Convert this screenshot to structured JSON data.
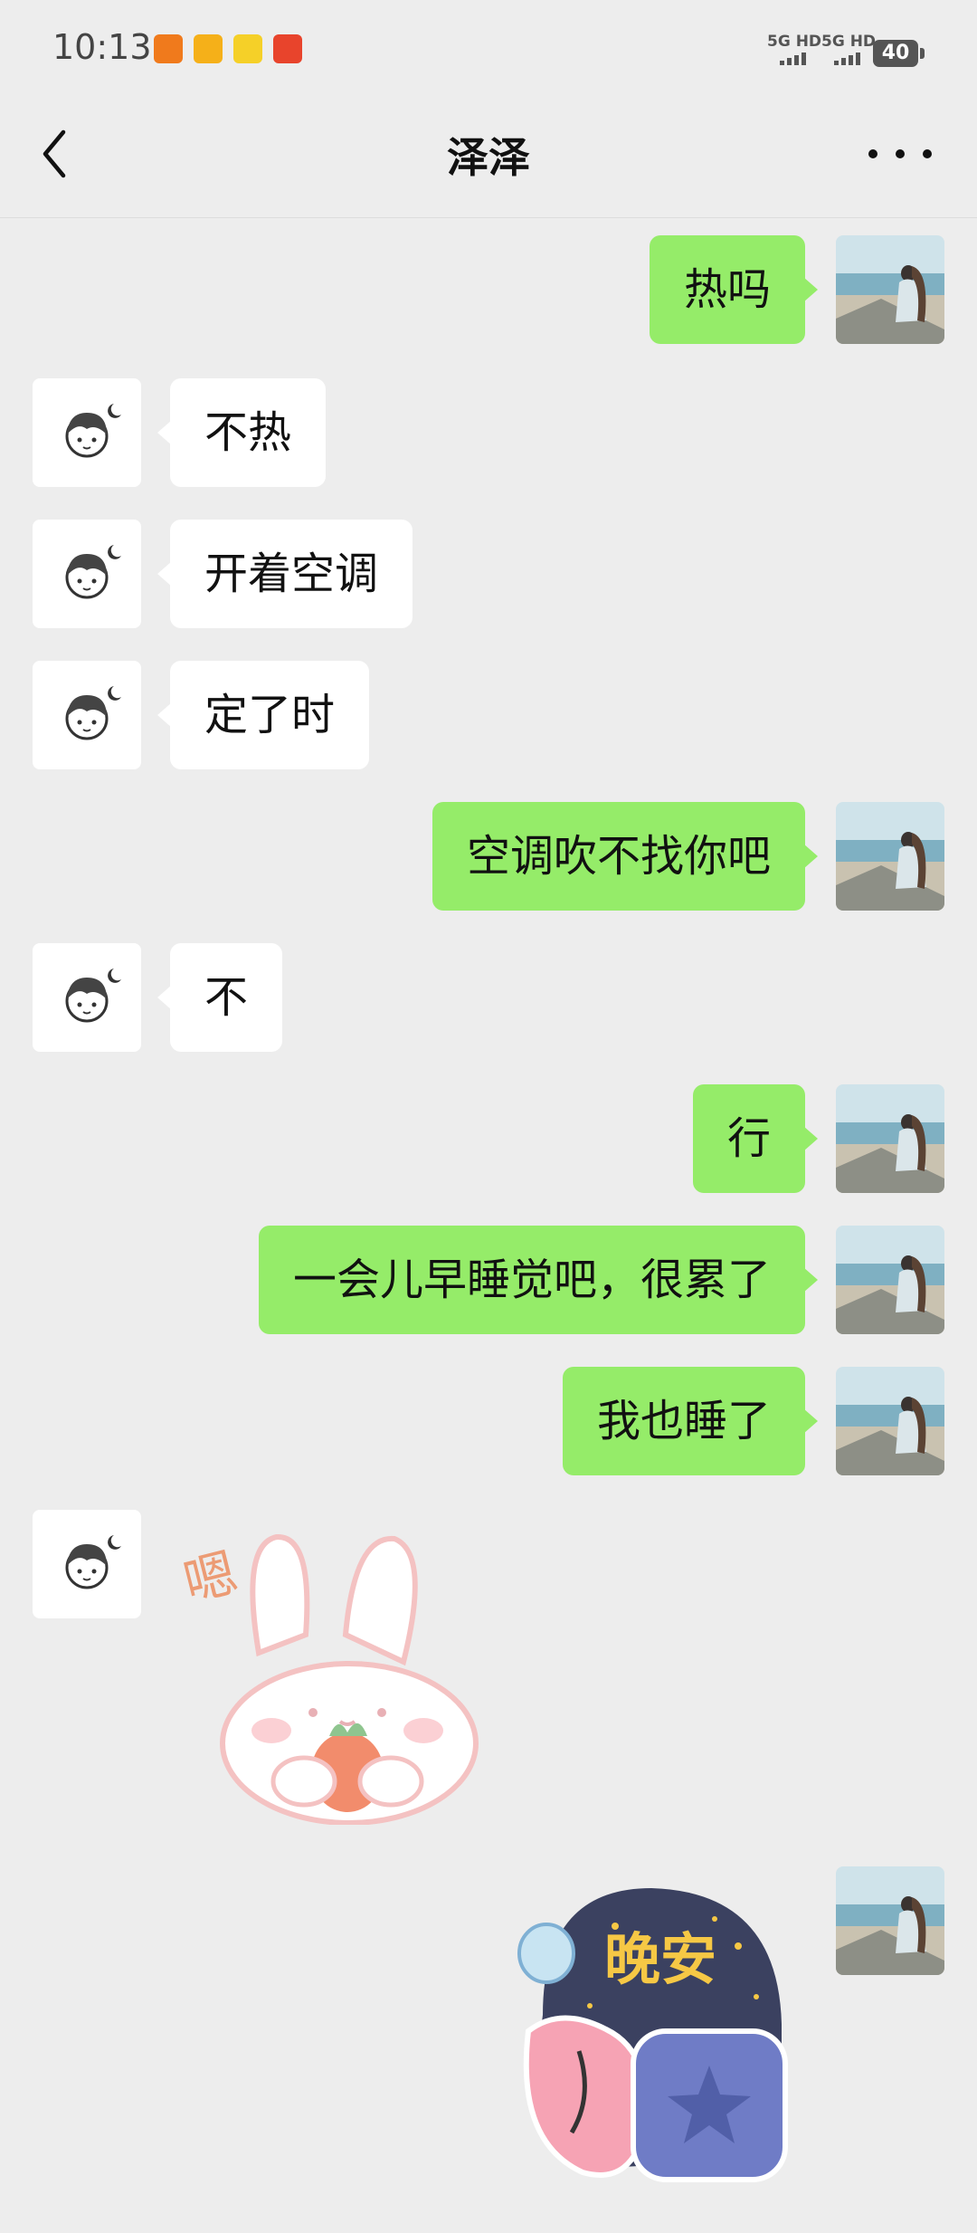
{
  "status_bar": {
    "time": "10:13",
    "network_1": "5G HD",
    "network_2": "5G HD",
    "battery": "40"
  },
  "header": {
    "title": "泽泽",
    "back_icon": "back-chevron-icon",
    "more_icon": "more-dots-icon"
  },
  "colors": {
    "me_bubble": "#95ec69",
    "other_bubble": "#ffffff",
    "background": "#ededed"
  },
  "messages": [
    {
      "sender": "me",
      "text": "热吗"
    },
    {
      "sender": "other",
      "text": "不热"
    },
    {
      "sender": "other",
      "text": "开着空调"
    },
    {
      "sender": "other",
      "text": "定了时"
    },
    {
      "sender": "me",
      "text": "空调吹不找你吧"
    },
    {
      "sender": "other",
      "text": "不"
    },
    {
      "sender": "me",
      "text": "行"
    },
    {
      "sender": "me",
      "text": "一会儿早睡觉吧，很累了"
    },
    {
      "sender": "me",
      "text": "我也睡了"
    },
    {
      "sender": "other",
      "sticker": "bunny-carrot-sticker",
      "text": "嗯"
    },
    {
      "sender": "me",
      "sticker": "goodnight-sticker",
      "text": "晚安"
    }
  ]
}
